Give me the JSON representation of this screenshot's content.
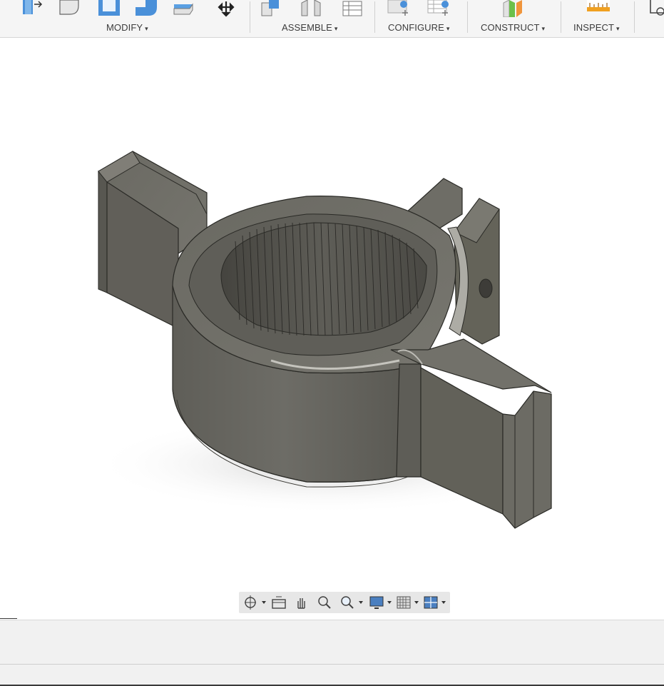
{
  "toolbar": {
    "groups": [
      {
        "label": "MODIFY",
        "caret": "▾"
      },
      {
        "label": "ASSEMBLE",
        "caret": "▾"
      },
      {
        "label": "CONFIGURE",
        "caret": "▾"
      },
      {
        "label": "CONSTRUCT",
        "caret": "▾"
      },
      {
        "label": "INSPECT",
        "caret": "▾"
      }
    ],
    "modify_tools": [
      "press-pull-icon",
      "fillet-icon",
      "shell-icon",
      "combine-icon",
      "replace-face-icon",
      "move-copy-icon"
    ],
    "assemble_tools": [
      "new-component-icon",
      "joint-icon",
      "bom-table-icon"
    ],
    "configure_tools": [
      "configure-parameters-icon",
      "configure-table-icon"
    ],
    "construct_tools": [
      "offset-plane-icon"
    ],
    "inspect_tools": [
      "measure-icon"
    ]
  },
  "viewport": {
    "model": "splined-clamp-hub",
    "body_color": "#6e6d66"
  },
  "navbar": {
    "items": [
      "orbit-icon",
      "look-at-icon",
      "pan-icon",
      "zoom-icon",
      "fit-icon",
      "display-settings-icon",
      "grid-settings-icon",
      "viewports-icon"
    ]
  }
}
